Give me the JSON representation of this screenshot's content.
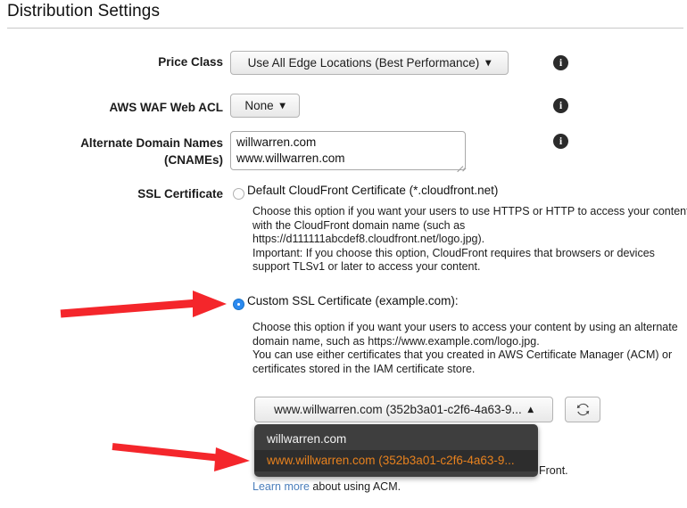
{
  "page": {
    "title": "Distribution Settings"
  },
  "fields": {
    "price_class": {
      "label": "Price Class",
      "value": "Use All Edge Locations (Best Performance)",
      "caret": "chevron-down",
      "options": [
        "Use All Edge Locations (Best Performance)"
      ]
    },
    "waf_acl": {
      "label": "AWS WAF Web ACL",
      "value": "None",
      "caret": "chevron-down",
      "options": [
        "None"
      ]
    },
    "cnames": {
      "label_line1": "Alternate Domain Names",
      "label_line2": "(CNAMEs)",
      "value": "willwarren.com\nwww.willwarren.com",
      "placeholder": ""
    },
    "ssl": {
      "label": "SSL Certificate",
      "default_option": {
        "label": "Default CloudFront Certificate (*.cloudfront.net)",
        "selected": false,
        "help": [
          "Choose this option if you want your users to use HTTPS or HTTP to access your content",
          "with the CloudFront domain name (such as",
          "https://d111111abcdef8.cloudfront.net/logo.jpg).",
          "Important: If you choose this option, CloudFront requires that browsers or devices",
          "support TLSv1 or later to access your content."
        ]
      },
      "custom_option": {
        "label": "Custom SSL Certificate (example.com):",
        "selected": true,
        "help": [
          "Choose this option if you want your users to access your content by using an alternate",
          "domain name, such as https://www.example.com/logo.jpg.",
          "You can use either certificates that you created in AWS Certificate Manager (ACM) or",
          "certificates stored in the IAM certificate store."
        ]
      },
      "certificate_select": {
        "value": "www.willwarren.com (352b3a01-c2f6-4a63-9...",
        "caret": "chevron-up",
        "expanded": true,
        "menu_items": [
          {
            "label": "willwarren.com",
            "highlighted": false
          },
          {
            "label": "www.willwarren.com (352b3a01-c2f6-4a63-9...",
            "highlighted": true
          }
        ]
      },
      "refresh_button": {
        "icon": "refresh-icon",
        "tooltip": "Refresh"
      },
      "obscured_text_tail": "Front.",
      "footer": {
        "link_text": "Learn more",
        "rest_text": " about using ACM."
      }
    }
  },
  "icons": {
    "info": "i",
    "info_label": "info-icon"
  },
  "annotations": {
    "arrow_color": "#f4262b",
    "arrows": [
      {
        "name": "arrow-to-custom-ssl-radio",
        "target": "Custom SSL Certificate radio"
      },
      {
        "name": "arrow-to-highlighted-menu-item",
        "target": "www.willwarren.com menu item"
      }
    ]
  },
  "colors": {
    "accent_blue": "#2b8af0",
    "menu_bg": "#3e3e3e",
    "menu_highlight_text": "#e8821e",
    "link": "#4a7ebb"
  }
}
